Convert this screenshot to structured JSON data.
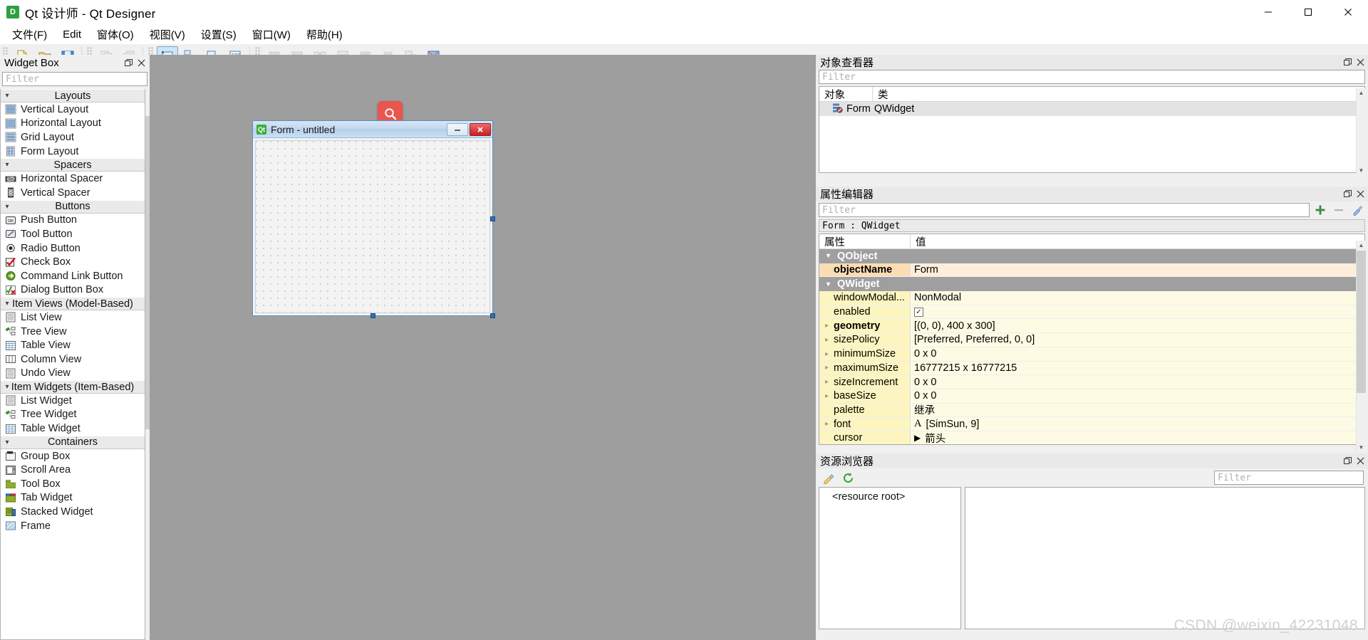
{
  "window": {
    "title": "Qt 设计师 - Qt Designer",
    "app_icon": "qt-designer-icon",
    "minimize_label": "minimize-icon",
    "maximize_label": "maximize-icon",
    "close_label": "close-icon"
  },
  "menubar": {
    "items": [
      {
        "label": "文件(F)",
        "name": "menu-file"
      },
      {
        "label": "Edit",
        "name": "menu-edit"
      },
      {
        "label": "窗体(O)",
        "name": "menu-form"
      },
      {
        "label": "视图(V)",
        "name": "menu-view"
      },
      {
        "label": "设置(S)",
        "name": "menu-settings"
      },
      {
        "label": "窗口(W)",
        "name": "menu-window"
      },
      {
        "label": "帮助(H)",
        "name": "menu-help"
      }
    ]
  },
  "toolbar": {
    "groups": [
      {
        "buttons": [
          {
            "name": "new-form-button",
            "icon": "new-file-icon",
            "state": "enabled"
          },
          {
            "name": "open-form-button",
            "icon": "open-folder-icon",
            "state": "enabled"
          },
          {
            "name": "save-form-button",
            "icon": "save-disk-icon",
            "state": "enabled"
          }
        ]
      },
      {
        "buttons": [
          {
            "name": "undo-button",
            "icon": "undo-icon",
            "state": "disabled"
          },
          {
            "name": "redo-button",
            "icon": "redo-icon",
            "state": "disabled"
          }
        ]
      },
      {
        "buttons": [
          {
            "name": "edit-widgets-button",
            "icon": "edit-widgets-icon",
            "state": "active"
          },
          {
            "name": "edit-signals-slots-button",
            "icon": "signals-slots-icon",
            "state": "enabled"
          },
          {
            "name": "edit-buddies-button",
            "icon": "buddies-icon",
            "state": "enabled"
          },
          {
            "name": "edit-tab-order-button",
            "icon": "tab-order-icon",
            "state": "enabled"
          }
        ]
      },
      {
        "buttons": [
          {
            "name": "layout-horizontally-button",
            "icon": "layout-horizontal-icon",
            "state": "disabled"
          },
          {
            "name": "layout-vertically-button",
            "icon": "layout-vertical-icon",
            "state": "disabled"
          },
          {
            "name": "layout-splitter-horizontal-button",
            "icon": "splitter-horizontal-icon",
            "state": "disabled"
          },
          {
            "name": "layout-splitter-vertical-button",
            "icon": "splitter-vertical-icon",
            "state": "disabled"
          },
          {
            "name": "layout-grid-button",
            "icon": "layout-grid-icon",
            "state": "disabled"
          },
          {
            "name": "layout-form-button",
            "icon": "layout-form-icon",
            "state": "disabled"
          },
          {
            "name": "break-layout-button",
            "icon": "break-layout-icon",
            "state": "disabled"
          },
          {
            "name": "adjust-size-button",
            "icon": "adjust-size-icon",
            "state": "enabled"
          }
        ]
      }
    ]
  },
  "widget_box": {
    "title": "Widget Box",
    "filter_placeholder": "Filter",
    "float_button": "undock-icon",
    "close_button": "close-icon",
    "categories": [
      {
        "label": "Layouts",
        "expanded": true,
        "items": [
          {
            "label": "Vertical Layout",
            "icon": "vertical-layout-icon"
          },
          {
            "label": "Horizontal Layout",
            "icon": "horizontal-layout-icon"
          },
          {
            "label": "Grid Layout",
            "icon": "grid-layout-icon"
          },
          {
            "label": "Form Layout",
            "icon": "form-layout-icon"
          }
        ]
      },
      {
        "label": "Spacers",
        "expanded": true,
        "items": [
          {
            "label": "Horizontal Spacer",
            "icon": "horizontal-spacer-icon"
          },
          {
            "label": "Vertical Spacer",
            "icon": "vertical-spacer-icon"
          }
        ]
      },
      {
        "label": "Buttons",
        "expanded": true,
        "items": [
          {
            "label": "Push Button",
            "icon": "push-button-icon"
          },
          {
            "label": "Tool Button",
            "icon": "tool-button-icon"
          },
          {
            "label": "Radio Button",
            "icon": "radio-button-icon"
          },
          {
            "label": "Check Box",
            "icon": "check-box-icon"
          },
          {
            "label": "Command Link Button",
            "icon": "command-link-button-icon"
          },
          {
            "label": "Dialog Button Box",
            "icon": "dialog-button-box-icon"
          }
        ]
      },
      {
        "label": "Item Views (Model-Based)",
        "expanded": true,
        "items": [
          {
            "label": "List View",
            "icon": "list-view-icon"
          },
          {
            "label": "Tree View",
            "icon": "tree-view-icon"
          },
          {
            "label": "Table View",
            "icon": "table-view-icon"
          },
          {
            "label": "Column View",
            "icon": "column-view-icon"
          },
          {
            "label": "Undo View",
            "icon": "undo-view-icon"
          }
        ]
      },
      {
        "label": "Item Widgets (Item-Based)",
        "expanded": true,
        "items": [
          {
            "label": "List Widget",
            "icon": "list-widget-icon"
          },
          {
            "label": "Tree Widget",
            "icon": "tree-widget-icon"
          },
          {
            "label": "Table Widget",
            "icon": "table-widget-icon"
          }
        ]
      },
      {
        "label": "Containers",
        "expanded": true,
        "items": [
          {
            "label": "Group Box",
            "icon": "group-box-icon"
          },
          {
            "label": "Scroll Area",
            "icon": "scroll-area-icon"
          },
          {
            "label": "Tool Box",
            "icon": "tool-box-icon"
          },
          {
            "label": "Tab Widget",
            "icon": "tab-widget-icon"
          },
          {
            "label": "Stacked Widget",
            "icon": "stacked-widget-icon"
          },
          {
            "label": "Frame",
            "icon": "frame-icon"
          }
        ]
      }
    ]
  },
  "canvas": {
    "form": {
      "title": "Form - untitled",
      "icon": "qt-form-icon",
      "minimize_label": "—",
      "close_label": "✕"
    },
    "search_badge_icon": "search-icon"
  },
  "object_inspector": {
    "title": "对象查看器",
    "float_button": "undock-icon",
    "close_button": "close-icon",
    "filter_placeholder": "Filter",
    "columns": [
      "对象",
      "类"
    ],
    "rows": [
      {
        "object": "Form",
        "class": "QWidget",
        "icon": "widget-icon",
        "selected": true
      }
    ]
  },
  "property_editor": {
    "title": "属性编辑器",
    "float_button": "undock-icon",
    "close_button": "close-icon",
    "filter_placeholder": "Filter",
    "add_button": "add-icon",
    "remove_button": "remove-icon",
    "configure_button": "configure-icon",
    "selected_object": "Form : QWidget",
    "columns": [
      "属性",
      "值"
    ],
    "rows": [
      {
        "kind": "group",
        "name": "QObject",
        "expanded": true
      },
      {
        "kind": "prop",
        "name": "objectName",
        "value": "Form",
        "highlight": "orange",
        "bold": true,
        "expandable": false
      },
      {
        "kind": "group",
        "name": "QWidget",
        "expanded": true
      },
      {
        "kind": "prop",
        "name": "windowModal...",
        "value": "NonModal",
        "highlight": "yellow",
        "expandable": false
      },
      {
        "kind": "prop",
        "name": "enabled",
        "value": "",
        "highlight": "yellow",
        "expandable": false,
        "checkbox": true,
        "checked": true
      },
      {
        "kind": "prop",
        "name": "geometry",
        "value": "[(0, 0), 400 x 300]",
        "highlight": "yellow",
        "bold": true,
        "expandable": true
      },
      {
        "kind": "prop",
        "name": "sizePolicy",
        "value": "[Preferred, Preferred, 0, 0]",
        "highlight": "yellow",
        "expandable": true
      },
      {
        "kind": "prop",
        "name": "minimumSize",
        "value": "0 x 0",
        "highlight": "yellow",
        "expandable": true
      },
      {
        "kind": "prop",
        "name": "maximumSize",
        "value": "16777215 x 16777215",
        "highlight": "yellow",
        "expandable": true
      },
      {
        "kind": "prop",
        "name": "sizeIncrement",
        "value": "0 x 0",
        "highlight": "yellow",
        "expandable": true
      },
      {
        "kind": "prop",
        "name": "baseSize",
        "value": "0 x 0",
        "highlight": "yellow",
        "expandable": true
      },
      {
        "kind": "prop",
        "name": "palette",
        "value": "继承",
        "highlight": "yellow",
        "expandable": false
      },
      {
        "kind": "prop",
        "name": "font",
        "value": "[SimSun, 9]",
        "highlight": "yellow",
        "expandable": true,
        "value_icon": "font-icon"
      },
      {
        "kind": "prop",
        "name": "cursor",
        "value": "箭头",
        "highlight": "yellow",
        "expandable": false,
        "value_icon": "cursor-icon"
      }
    ]
  },
  "resource_browser": {
    "title": "资源浏览器",
    "float_button": "undock-icon",
    "close_button": "close-icon",
    "edit_button": "pencil-icon",
    "reload_button": "reload-icon",
    "filter_placeholder": "Filter",
    "root_label": "<resource root>"
  },
  "watermark": "CSDN @weixin_42231048",
  "colors": {
    "accent_blue": "#2f6fb5",
    "selection": "#cde6f7",
    "badge_red": "#e8564e",
    "group_gray": "#9f9f9f",
    "prop_orange": "#fbddb4",
    "prop_yellow": "#fcf5bf",
    "canvas_gray": "#9e9e9e"
  }
}
